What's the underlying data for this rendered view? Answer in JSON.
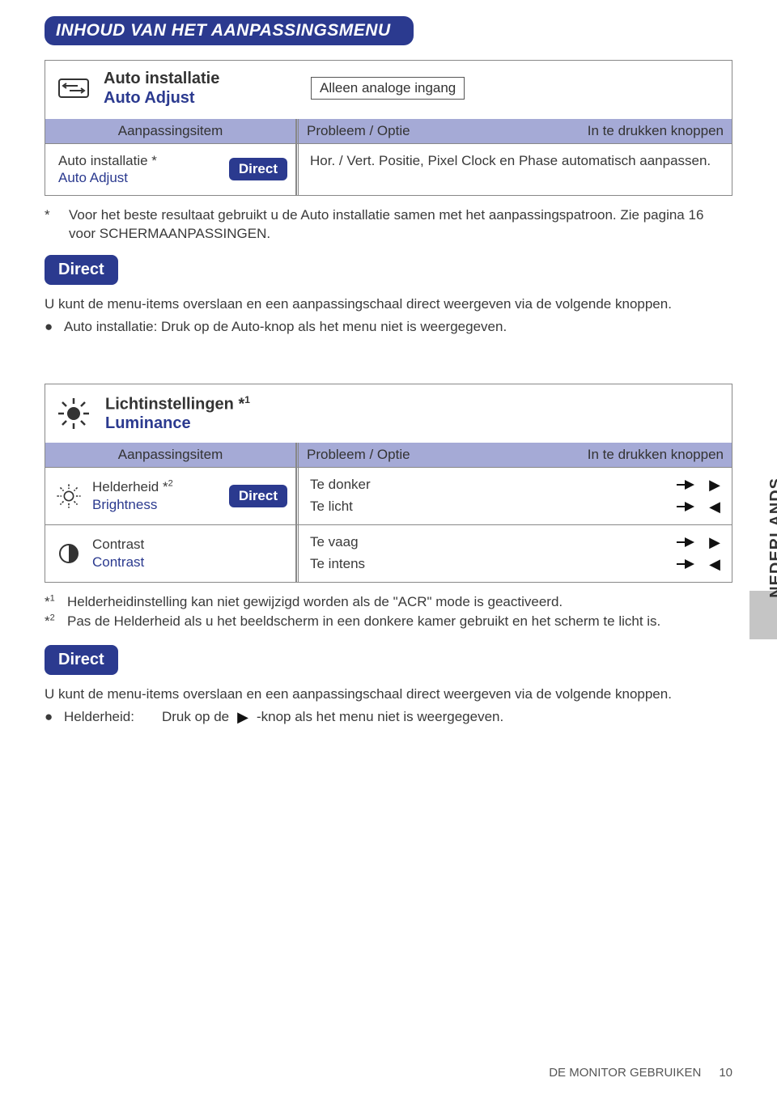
{
  "page_title": "INHOUD VAN HET AANPASSINGSMENU",
  "side_tab": "NEDERLANDS",
  "auto_section": {
    "title_nl": "Auto installatie",
    "title_en": "Auto Adjust",
    "note": "Alleen analoge ingang",
    "col_item": "Aanpassingsitem",
    "col_problem": "Probleem / Optie",
    "col_buttons": "In te drukken knoppen",
    "row_label_1": "Auto installatie *",
    "row_label_2": "Auto Adjust",
    "direct": "Direct",
    "row_desc": "Hor. / Vert. Positie, Pixel Clock en Phase automatisch aanpassen."
  },
  "star_note_1": "Voor het beste resultaat gebruikt u de Auto installatie samen met het aanpassingspatroon. Zie pagina 16 voor SCHERMAANPASSINGEN.",
  "direct_label": "Direct",
  "direct_para_1": "U kunt de menu-items overslaan en een aanpassingschaal direct weergeven via de volgende knoppen.",
  "bullet_auto": "Auto installatie: Druk op de Auto-knop als het menu niet is weergegeven.",
  "lum_section": {
    "title_nl": "Lichtinstellingen *",
    "title_en": "Luminance",
    "col_item": "Aanpassingsitem",
    "col_problem": "Probleem / Optie",
    "col_buttons": "In te drukken knoppen",
    "brightness": {
      "label_nl": "Helderheid *",
      "label_en": "Brightness",
      "direct": "Direct",
      "opt1": "Te donker",
      "opt2": "Te licht"
    },
    "contrast": {
      "label_nl": "Contrast",
      "label_en": "Contrast",
      "opt1": "Te vaag",
      "opt2": "Te intens"
    }
  },
  "fn1": "Helderheidinstelling kan niet gewijzigd worden als de \"ACR\" mode is geactiveerd.",
  "fn2": "Pas de Helderheid als u het beeldscherm in een donkere kamer gebruikt en het scherm te licht is.",
  "direct_para_2": "U kunt de menu-items overslaan en een aanpassingschaal direct weergeven via de volgende knoppen.",
  "bullet_bright_prefix": "Helderheid:",
  "bullet_bright_mid": "Druk op de",
  "bullet_bright_suffix": "-knop als het menu niet is weergegeven.",
  "footer_text": "DE MONITOR GEBRUIKEN",
  "footer_page": "10"
}
